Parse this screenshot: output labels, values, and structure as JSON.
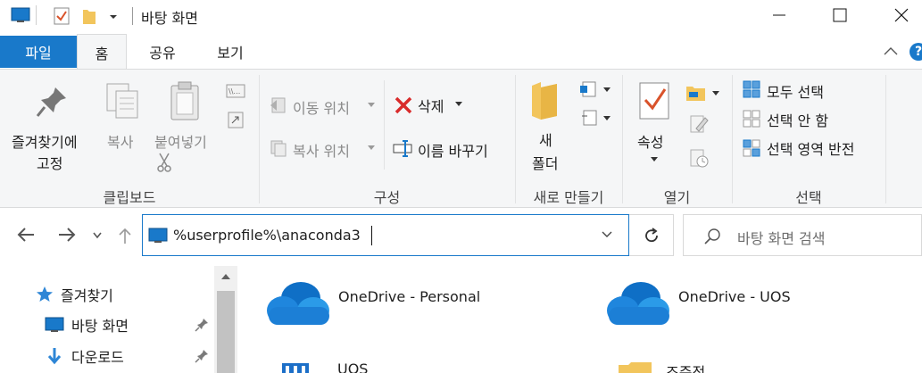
{
  "window": {
    "title": "바탕 화면"
  },
  "tabs": {
    "file": "파일",
    "home": "홈",
    "share": "공유",
    "view": "보기"
  },
  "ribbon": {
    "clipboard": {
      "pin_line1": "즐겨찾기에",
      "pin_line2": "고정",
      "copy": "복사",
      "paste": "붙여넣기",
      "label": "클립보드"
    },
    "organize": {
      "move_to": "이동 위치",
      "copy_to": "복사 위치",
      "delete": "삭제",
      "rename": "이름 바꾸기",
      "label": "구성"
    },
    "new": {
      "new_line1": "새",
      "new_line2": "폴더",
      "label": "새로 만들기"
    },
    "open": {
      "properties": "속성",
      "label": "열기"
    },
    "select": {
      "select_all": "모두 선택",
      "select_none": "선택 안 함",
      "invert": "선택 영역 반전",
      "label": "선택"
    }
  },
  "address": {
    "value": "%userprofile%\\anaconda3"
  },
  "search": {
    "placeholder": "바탕 화면 검색"
  },
  "nav": {
    "items": [
      {
        "label": "즐겨찾기",
        "icon": "star-icon"
      },
      {
        "label": "바탕 화면",
        "icon": "desktop-icon",
        "pinned": true
      },
      {
        "label": "다운로드",
        "icon": "download-icon",
        "pinned": true
      }
    ]
  },
  "content": {
    "tiles": [
      {
        "label": "OneDrive - Personal",
        "icon": "cloud-icon"
      },
      {
        "label": "OneDrive - UOS",
        "icon": "cloud-icon"
      },
      {
        "label": "UOS",
        "icon": "building-icon"
      },
      {
        "label": "조준적",
        "icon": "folder-icon"
      }
    ]
  },
  "colors": {
    "accent": "#1979ca",
    "onedrive": "#0f6fc6",
    "folder": "#f2c55c",
    "delete": "#d92b2b"
  }
}
